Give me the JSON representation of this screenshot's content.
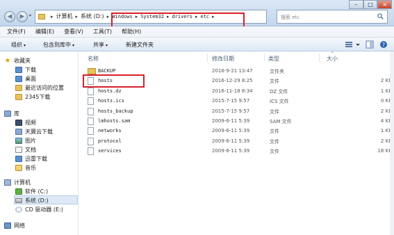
{
  "window": {
    "controls": {
      "minimize": "–",
      "maximize": "□",
      "close": "×"
    }
  },
  "address": {
    "segments": [
      "计算机",
      "系统 (D:)",
      "Windows",
      "System32",
      "drivers",
      "etc"
    ],
    "separator": "▸",
    "dropdown": "▾",
    "refresh": "↻"
  },
  "search": {
    "placeholder": "搜索 etc"
  },
  "menu": [
    "文件(F)",
    "编辑(E)",
    "查看(V)",
    "工具(T)",
    "帮助(H)"
  ],
  "toolbar": {
    "organize": "组织",
    "include": "包含到库中",
    "share": "共享",
    "new_folder": "新建文件夹",
    "dropdown": "▾"
  },
  "nav": {
    "favorites": "收藏夹",
    "downloads": "下载",
    "desktop": "桌面",
    "recent": "最近访问的位置",
    "app2345": "2345下载",
    "libraries": "库",
    "videos": "视频",
    "tianyi": "天翼云下载",
    "pictures": "图片",
    "documents": "文档",
    "xunlei": "迅雷下载",
    "music": "音乐",
    "computer": "计算机",
    "drive_c": "软件 (C:)",
    "drive_d": "系统 (D:)",
    "drive_e": "CD 驱动器 (E:)",
    "network": "网络"
  },
  "columns": {
    "name": "名称",
    "date": "修改日期",
    "type": "类型",
    "size": "大小",
    "sort": "^"
  },
  "files": [
    {
      "name": "BACKUP",
      "date": "2016-9-21 13:47",
      "type": "文件夹",
      "size": "",
      "folder": true
    },
    {
      "name": "hosts",
      "date": "2016-12-29 8:25",
      "type": "文件",
      "size": "2 KB",
      "folder": false
    },
    {
      "name": "hosts.dz",
      "date": "2016-11-18 8:34",
      "type": "DZ 文件",
      "size": "1 KB",
      "folder": false
    },
    {
      "name": "hosts.ics",
      "date": "2015-7-15 9:57",
      "type": "ICS 文件",
      "size": "0 KB",
      "folder": false
    },
    {
      "name": "hosts_backup",
      "date": "2015-7-15 9:57",
      "type": "文件",
      "size": "2 KB",
      "folder": false
    },
    {
      "name": "lmhosts.sam",
      "date": "2009-6-11 5:39",
      "type": "SAM 文件",
      "size": "4 KB",
      "folder": false
    },
    {
      "name": "networks",
      "date": "2009-6-11 5:39",
      "type": "文件",
      "size": "1 KB",
      "folder": false
    },
    {
      "name": "protocol",
      "date": "2009-6-11 5:39",
      "type": "文件",
      "size": "2 KB",
      "folder": false
    },
    {
      "name": "services",
      "date": "2009-6-11 5:39",
      "type": "文件",
      "size": "18 KB",
      "folder": false
    }
  ],
  "icons": {
    "back": "back-arrow-icon",
    "forward": "forward-arrow-icon",
    "search": "search-icon",
    "details_view": "view-details-icon",
    "preview": "preview-pane-icon",
    "help": "help-icon"
  },
  "highlight_color": "#d8202a"
}
